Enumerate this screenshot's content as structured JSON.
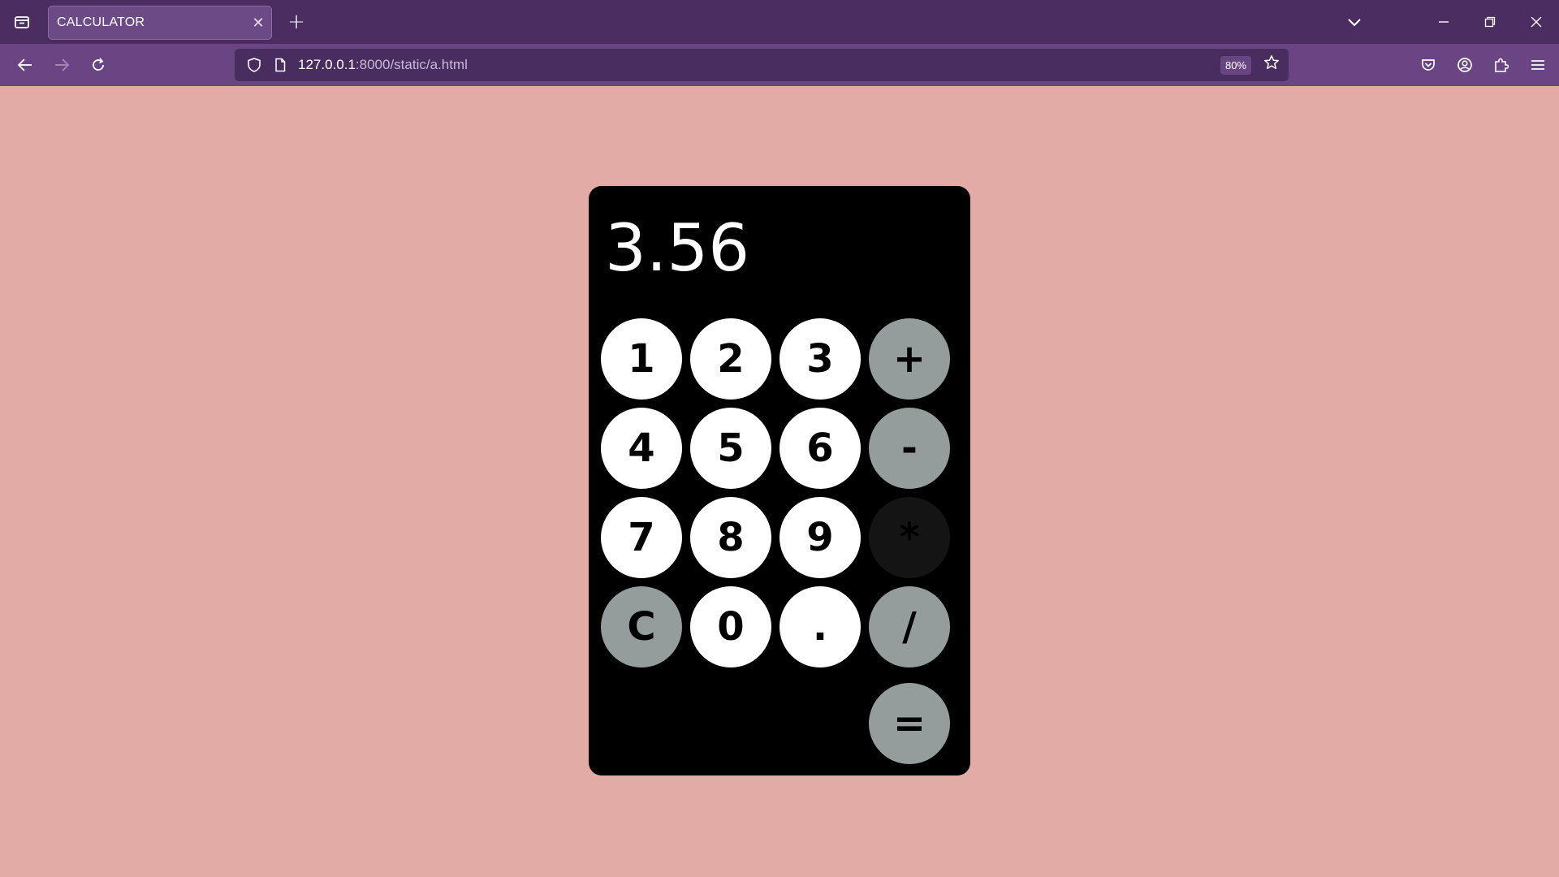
{
  "browser": {
    "tab_title": "CALCULATOR",
    "url_host": "127.0.0.1",
    "url_rest": ":8000/static/a.html",
    "zoom": "80%"
  },
  "calculator": {
    "display": "3.56",
    "keys": {
      "k1": "1",
      "k2": "2",
      "k3": "3",
      "plus": "+",
      "k4": "4",
      "k5": "5",
      "k6": "6",
      "minus": "-",
      "k7": "7",
      "k8": "8",
      "k9": "9",
      "multiply": "*",
      "clear": "C",
      "k0": "0",
      "dot": ".",
      "divide": "/",
      "equals": "="
    }
  },
  "colors": {
    "page_background": "#e2aba5",
    "calculator_body": "#000000",
    "digit_key": "#ffffff",
    "operator_key": "#949d9c",
    "active_operator_key": "#141414",
    "tabbar": "#4c2d61",
    "navbar": "#6a4584"
  }
}
